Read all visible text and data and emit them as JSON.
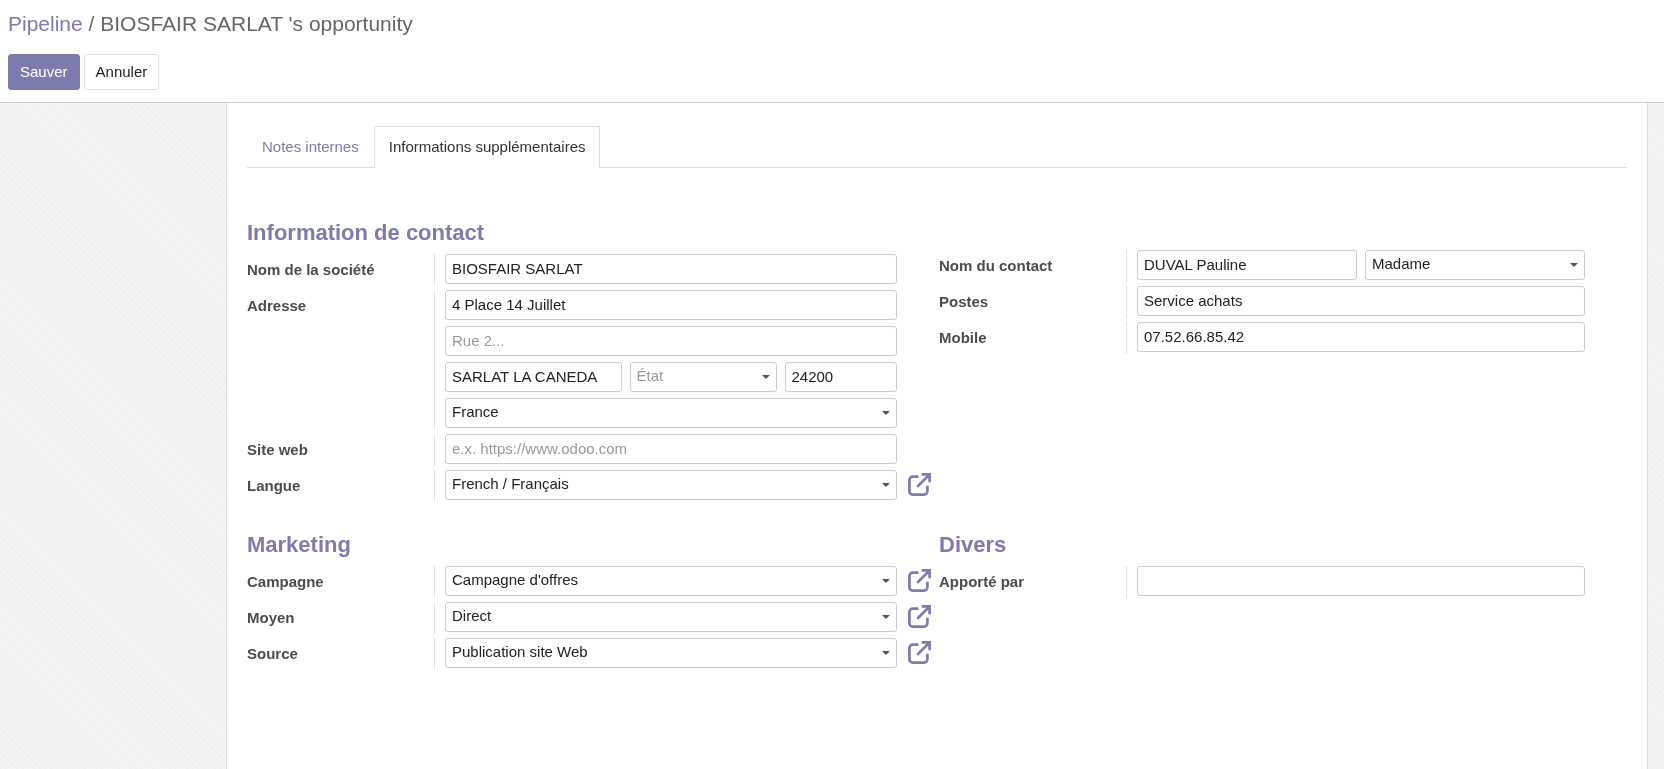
{
  "breadcrumb": {
    "parent": "Pipeline",
    "separator": "/",
    "current": "BIOSFAIR SARLAT 's opportunity"
  },
  "buttons": [
    {
      "label": "Sauver",
      "kind": "primary"
    },
    {
      "label": "Annuler",
      "kind": "secondary"
    }
  ],
  "tabs": [
    {
      "label": "Notes internes",
      "selected": false
    },
    {
      "label": "Informations supplémentaires",
      "selected": true
    }
  ],
  "rows": [
    {
      "left": {
        "title": "Information de contact",
        "fields": [
          {
            "label": "Nom de la société",
            "external_link": false,
            "lines": [
              [
                {
                  "kind": "text",
                  "value": "BIOSFAIR SARLAT"
                }
              ]
            ]
          },
          {
            "label": "Adresse",
            "external_link": false,
            "lines": [
              [
                {
                  "kind": "text",
                  "value": "4 Place 14 Juillet"
                }
              ],
              [
                {
                  "kind": "text",
                  "placeholder": "Rue 2..."
                }
              ],
              [
                {
                  "kind": "text",
                  "value": "SARLAT LA CANEDA"
                },
                {
                  "kind": "select",
                  "placeholder": "État"
                },
                {
                  "kind": "text",
                  "value": "24200"
                }
              ],
              [
                {
                  "kind": "select",
                  "value": "France"
                }
              ]
            ]
          },
          {
            "label": "Site web",
            "external_link": false,
            "lines": [
              [
                {
                  "kind": "text",
                  "placeholder": "e.x. https://www.odoo.com"
                }
              ]
            ]
          },
          {
            "label": "Langue",
            "external_link": true,
            "lines": [
              [
                {
                  "kind": "select",
                  "value": "French / Français"
                }
              ]
            ]
          }
        ]
      },
      "right": {
        "fields": [
          {
            "label": "Nom du contact",
            "external_link": false,
            "lines": [
              [
                {
                  "kind": "text",
                  "value": "DUVAL Pauline"
                },
                {
                  "kind": "select",
                  "value": "Madame"
                }
              ]
            ]
          },
          {
            "label": "Postes",
            "external_link": false,
            "lines": [
              [
                {
                  "kind": "text",
                  "value": "Service achats"
                }
              ]
            ]
          },
          {
            "label": "Mobile",
            "external_link": false,
            "lines": [
              [
                {
                  "kind": "text",
                  "value": "07.52.66.85.42"
                }
              ]
            ]
          }
        ]
      }
    },
    {
      "left": {
        "title": "Marketing",
        "fields": [
          {
            "label": "Campagne",
            "external_link": true,
            "lines": [
              [
                {
                  "kind": "select",
                  "value": "Campagne d'offres"
                }
              ]
            ]
          },
          {
            "label": "Moyen",
            "external_link": true,
            "lines": [
              [
                {
                  "kind": "select",
                  "value": "Direct"
                }
              ]
            ]
          },
          {
            "label": "Source",
            "external_link": true,
            "lines": [
              [
                {
                  "kind": "select",
                  "value": "Publication site Web"
                }
              ]
            ]
          }
        ]
      },
      "right": {
        "title": "Divers",
        "fields": [
          {
            "label": "Apporté par",
            "external_link": false,
            "lines": [
              [
                {
                  "kind": "text"
                }
              ]
            ]
          }
        ]
      }
    }
  ]
}
